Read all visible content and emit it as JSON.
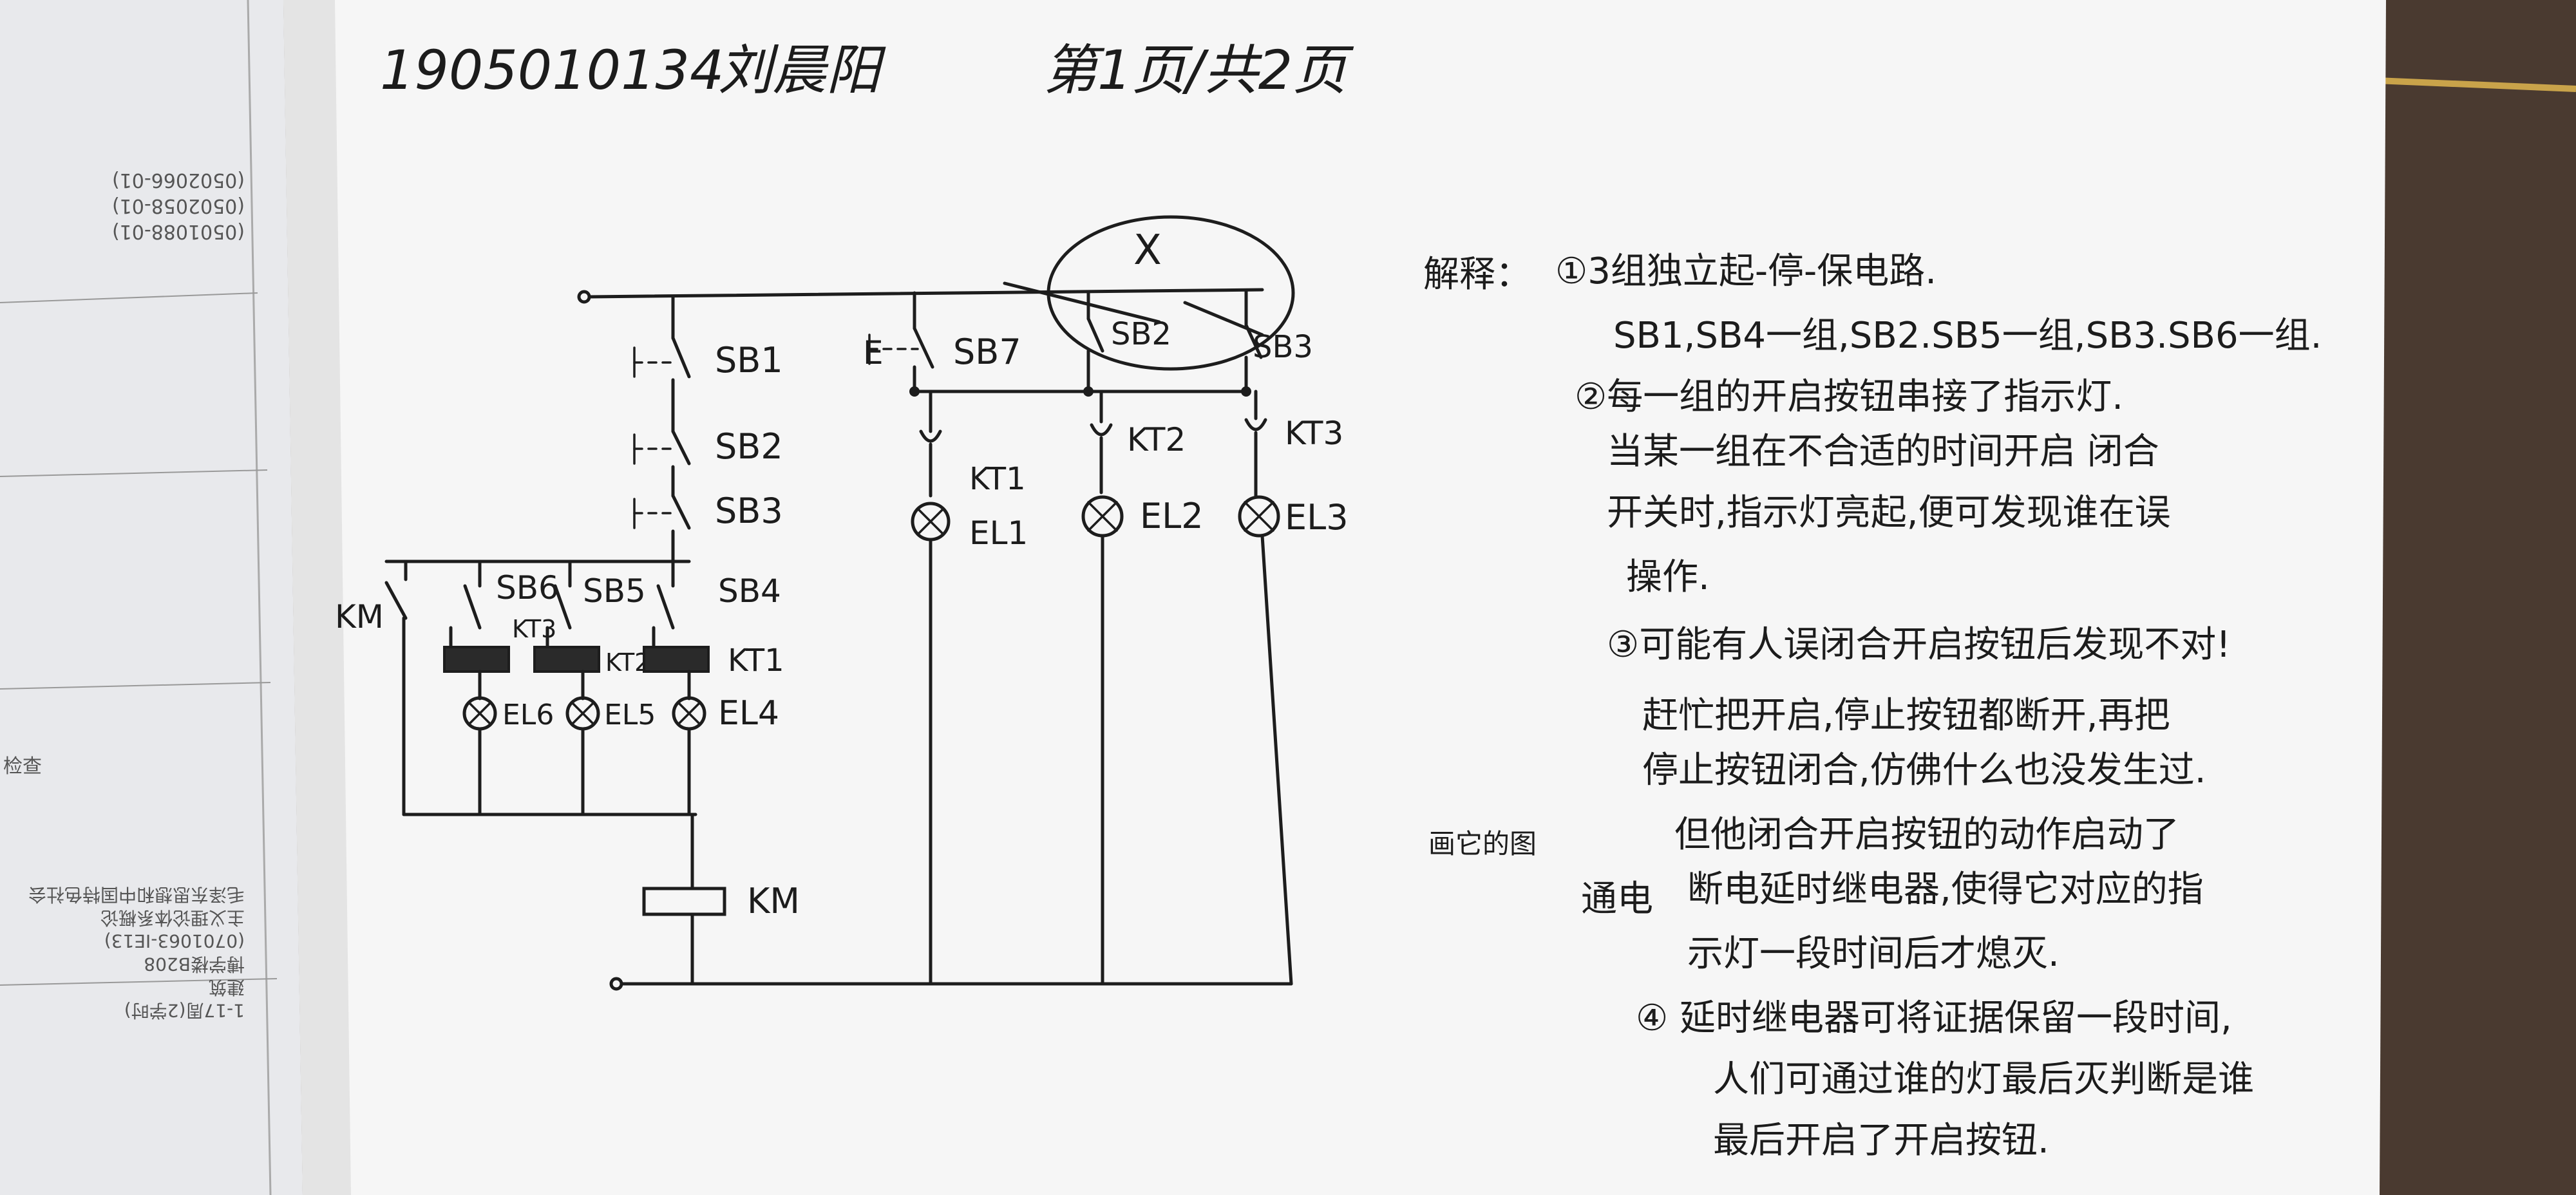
{
  "header": {
    "student_id": "1905010134",
    "name": "刘晨阳",
    "page": "第1页/共2页"
  },
  "left_page": {
    "codes": [
      "(0501088-01)",
      "(0502058-01)",
      "(0502066-01)"
    ],
    "lines": [
      "1-17周(2学时)",
      "建筑",
      "博学楼B208",
      "(0701063-IE13)",
      "主义理论体系概论",
      "毛泽东思想和中国特色社会"
    ],
    "side_char": "检查"
  },
  "diagram": {
    "switches": [
      "SB1",
      "SB2",
      "SB3",
      "SB4",
      "SB5",
      "SB6",
      "SB7",
      "SB2",
      "SB3"
    ],
    "e_mark": "E",
    "contacts": [
      "KT1",
      "KT2",
      "KT3"
    ],
    "lamps_right": [
      "EL1",
      "EL2",
      "EL3"
    ],
    "lamps_left": [
      "EL6",
      "EL5",
      "EL4"
    ],
    "relays": [
      "KT3",
      "KT2",
      "KT1"
    ],
    "coil": "KM",
    "km_contact": "KM",
    "cross_mark": "X"
  },
  "notes": {
    "title": "解释：",
    "items": [
      "①3组独立起-停-保电路.",
      "SB1,SB4一组,SB2.SB5一组,SB3.SB6一组.",
      "②每一组的开启按钮串接了指示灯.",
      "当某一组在不合适的时间开启 闭合",
      "开关时,指示灯亮起,便可发现谁在误",
      "操作.",
      "③可能有人误闭合开启按钮后发现不对!",
      "赶忙把开启,停止按钮都断开,再把",
      "停止按钮闭合,仿佛什么也没发生过.",
      "但他闭合开启按钮的动作启动了",
      "断电延时继电器,使得它对应的指",
      "示灯一段时间后才熄灭.",
      "④ 延时继电器可将证据保留一段时间,",
      "人们可通过谁的灯最后灭判断是谁",
      "最后开启了开启按钮."
    ],
    "margin_label": "画它的图",
    "margin_word": "通电"
  }
}
